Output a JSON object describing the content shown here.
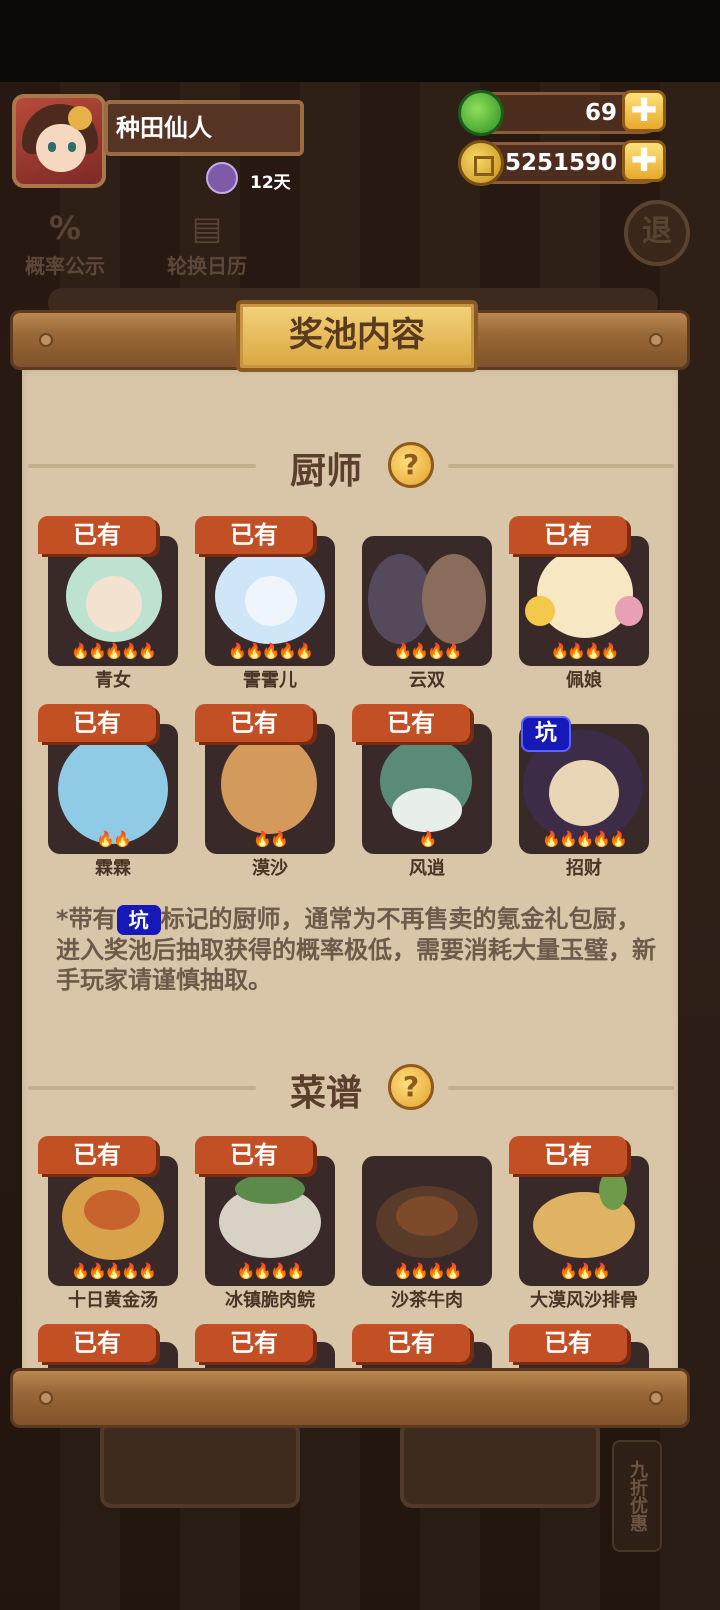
{
  "header": {
    "player_name": "种田仙人",
    "days_label": "12天",
    "jade_amount": "69",
    "coin_amount": "5251590",
    "plus_label": "✚"
  },
  "toolbar": {
    "probability_label": "概率公示",
    "calendar_label": "轮换日历",
    "exit_label": "退"
  },
  "panel": {
    "title": "奖池内容"
  },
  "chefs": {
    "section_title": "厨师",
    "help_label": "?",
    "items": [
      {
        "name": "青女",
        "owned": "已有",
        "flames": "🔥🔥🔥🔥🔥"
      },
      {
        "name": "霅霅儿",
        "owned": "已有",
        "flames": "🔥🔥🔥🔥🔥"
      },
      {
        "name": "云双",
        "owned": "",
        "flames": "🔥🔥🔥🔥"
      },
      {
        "name": "佩娘",
        "owned": "已有",
        "flames": "🔥🔥🔥🔥"
      },
      {
        "name": "霖霖",
        "owned": "已有",
        "flames": "🔥🔥"
      },
      {
        "name": "漠沙",
        "owned": "已有",
        "flames": "🔥🔥"
      },
      {
        "name": "风逍",
        "owned": "已有",
        "flames": "🔥"
      },
      {
        "name": "招财",
        "pit": "坑",
        "flames": "🔥🔥🔥🔥🔥"
      }
    ],
    "note_prefix": "*带有",
    "note_pit": "坑",
    "note_text": "标记的厨师，通常为不再售卖的氪金礼包厨，进入奖池后抽取获得的概率极低，需要消耗大量玉璧，新手玩家请谨慎抽取。"
  },
  "recipes": {
    "section_title": "菜谱",
    "help_label": "?",
    "items": [
      {
        "name": "十日黄金汤",
        "owned": "已有",
        "flames": "🔥🔥🔥🔥🔥"
      },
      {
        "name": "冰镇脆肉鲩",
        "owned": "已有",
        "flames": "🔥🔥🔥🔥"
      },
      {
        "name": "沙茶牛肉",
        "owned": "",
        "flames": "🔥🔥🔥🔥"
      },
      {
        "name": "大漠风沙排骨",
        "owned": "已有",
        "flames": "🔥🔥🔥"
      },
      {
        "name": "",
        "owned": "已有",
        "flames": ""
      },
      {
        "name": "",
        "owned": "已有",
        "flames": ""
      },
      {
        "name": "",
        "owned": "已有",
        "flames": ""
      },
      {
        "name": "",
        "owned": "已有",
        "flames": ""
      }
    ]
  },
  "bottom": {
    "side_label": "九折优惠"
  },
  "colors": {
    "owned_tag": "#c34f25",
    "pit_tag": "#1718b8",
    "paper": "#d9c6a8",
    "card_bg": "#3a2929"
  }
}
